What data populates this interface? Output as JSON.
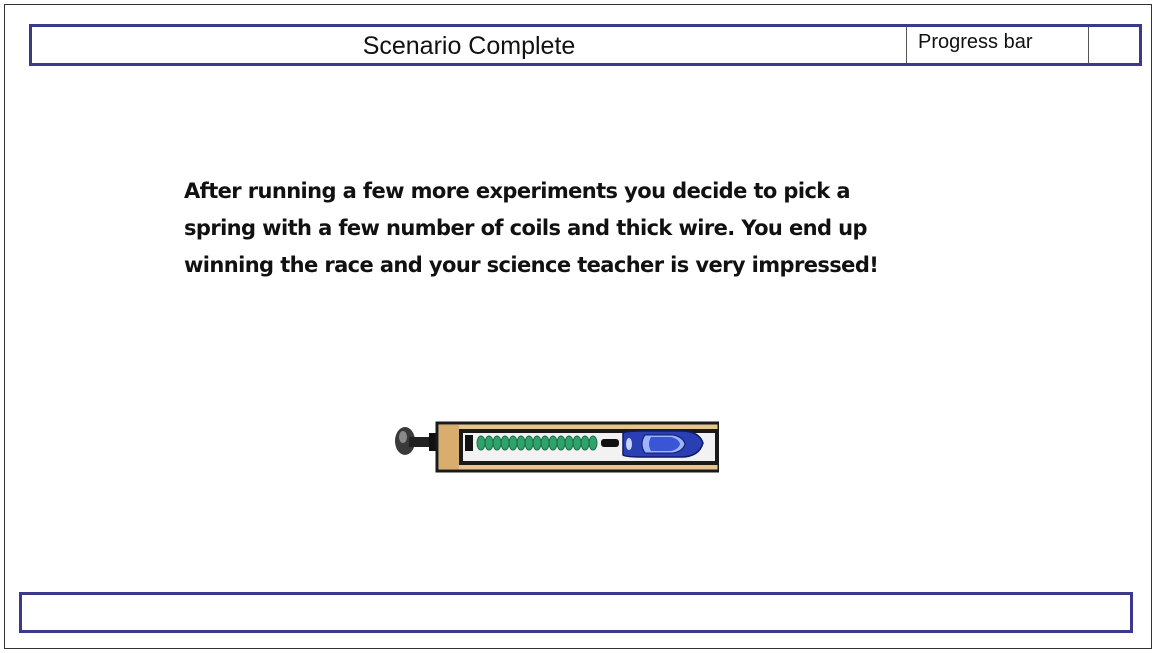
{
  "header": {
    "title": "Scenario Complete",
    "progress_label": "Progress bar"
  },
  "message": {
    "lines": [
      "After running a few more experiments you decide to pick a",
      "spring with a few number of coils and thick wire.  You end up",
      "winning the race and your science teacher is very impressed!"
    ]
  },
  "illustration": {
    "icon": "spring-launcher-with-car-icon",
    "colors": {
      "wood": "#e8c48e",
      "spring": "#2fa36b",
      "car": "#2b3fb5",
      "plunger": "#333333"
    }
  },
  "colors": {
    "border_accent": "#3b3a8a"
  }
}
